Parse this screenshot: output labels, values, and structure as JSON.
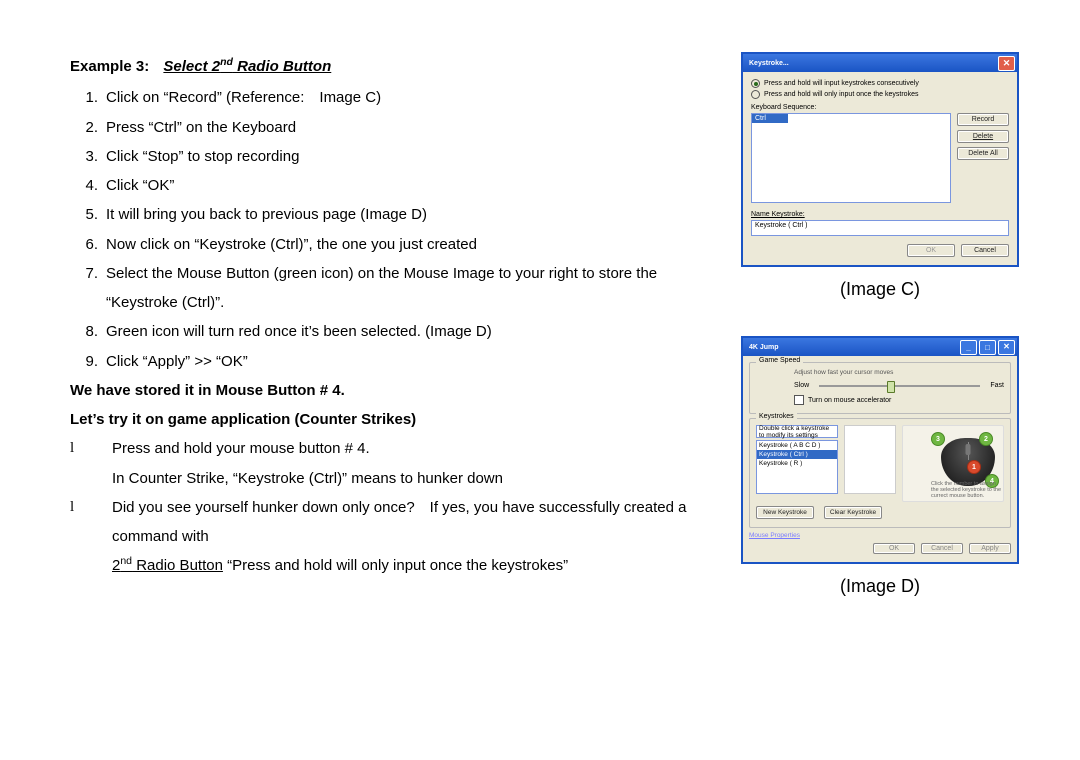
{
  "title": {
    "label": "Example 3:",
    "text_pre": "Select 2",
    "text_sup": "nd",
    "text_post": " Radio Button"
  },
  "steps": [
    "Click on “Record” (Reference: Image C)",
    "Press “Ctrl” on the Keyboard",
    "Click “Stop” to stop recording",
    "Click “OK”",
    "It will bring you back to previous page (Image D)",
    "Now click on “Keystroke (Ctrl)”, the one you just created",
    "Select the Mouse Button (green icon) on the Mouse Image to your right to store the “Keystroke (Ctrl)”.",
    "Green icon will turn red once it’s been selected. (Image D)",
    "Click “Apply” >> “OK”"
  ],
  "subhead1": "We have stored it in Mouse Button # 4.",
  "subhead2": "Let’s try it on game application (Counter Strikes)",
  "bullets": {
    "b1_l1": "Press and hold your mouse button # 4.",
    "b1_l2": "In Counter Strike, “Keystroke (Ctrl)” means to hunker down",
    "b2_l1": "Did you see yourself hunker down only once? If yes, you have successfully created a command with",
    "b2_u_pre": "2",
    "b2_u_sup": "nd",
    "b2_u_post": " Radio Button",
    "b2_tail": " “Press and hold will only input once the keystrokes”"
  },
  "captions": {
    "c": "(Image C)",
    "d": "(Image D)"
  },
  "imgC": {
    "title": "Keystroke...",
    "radio1": "Press and hold will input keystrokes consecutively",
    "radio2": "Press and hold will only input once the keystrokes",
    "seq_label": "Keyboard Sequence:",
    "sel_item": "Ctrl",
    "btn_record": "Record",
    "btn_delete": "Delete",
    "btn_deleteall": "Delete All",
    "name_label": "Name Keystroke:",
    "name_value": "Keystroke ( Ctrl )",
    "ok": "OK",
    "cancel": "Cancel"
  },
  "imgD": {
    "title": "4K Jump",
    "g1": "Game Speed",
    "speed_hint": "Adjust how fast your cursor moves",
    "slow": "Slow",
    "fast": "Fast",
    "chk": "Turn on mouse accelerator",
    "g2": "Keystrokes",
    "combo": "Double click a keystroke to modify its settings",
    "k1": "Keystroke ( A B C D )",
    "k2": "Keystroke ( Ctrl )",
    "k3": "Keystroke ( R )",
    "hint": "Click the number to assign the selected keystroke to the currect mouse button.",
    "new": "New Keystroke",
    "clear": "Clear Keystroke",
    "mprop": "Mouse Properties",
    "ok": "OK",
    "cancel": "Cancel",
    "apply": "Apply"
  }
}
